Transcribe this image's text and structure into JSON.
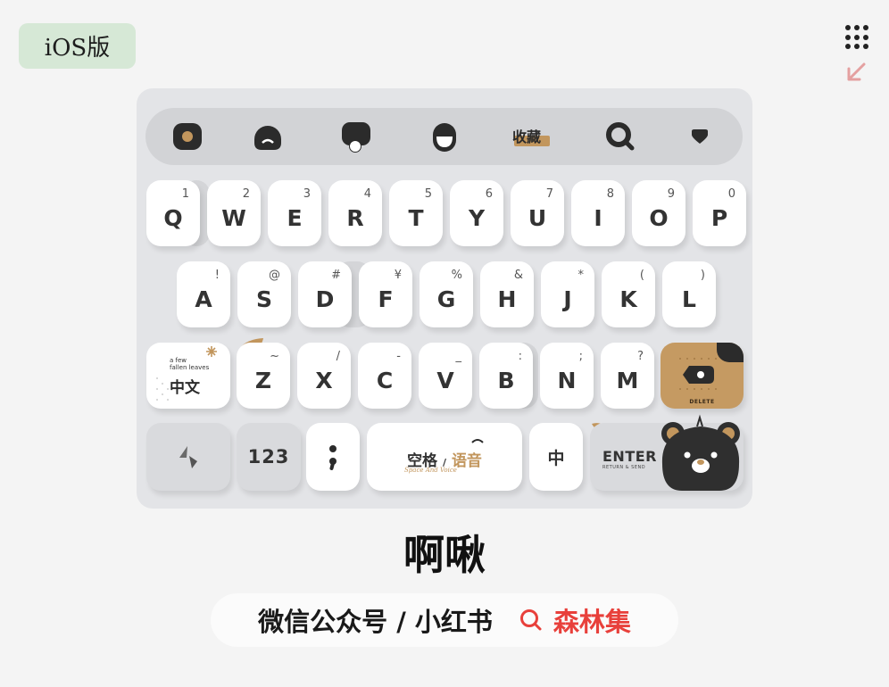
{
  "badge": {
    "label": "iOS版"
  },
  "toolbar": {
    "favorite_label": "收藏"
  },
  "rows": {
    "row1": [
      {
        "key": "Q",
        "sub": "1"
      },
      {
        "key": "W",
        "sub": "2"
      },
      {
        "key": "E",
        "sub": "3"
      },
      {
        "key": "R",
        "sub": "4"
      },
      {
        "key": "T",
        "sub": "5"
      },
      {
        "key": "Y",
        "sub": "6"
      },
      {
        "key": "U",
        "sub": "7"
      },
      {
        "key": "I",
        "sub": "8"
      },
      {
        "key": "O",
        "sub": "9"
      },
      {
        "key": "P",
        "sub": "0"
      }
    ],
    "row2": [
      {
        "key": "A",
        "sub": "!"
      },
      {
        "key": "S",
        "sub": "@"
      },
      {
        "key": "D",
        "sub": "#"
      },
      {
        "key": "F",
        "sub": "¥"
      },
      {
        "key": "G",
        "sub": "%"
      },
      {
        "key": "H",
        "sub": "&"
      },
      {
        "key": "J",
        "sub": "*"
      },
      {
        "key": "K",
        "sub": "("
      },
      {
        "key": "L",
        "sub": ")"
      }
    ],
    "row3": [
      {
        "key": "Z",
        "sub": "~"
      },
      {
        "key": "X",
        "sub": "/"
      },
      {
        "key": "C",
        "sub": "-"
      },
      {
        "key": "V",
        "sub": "_"
      },
      {
        "key": "B",
        "sub": ":"
      },
      {
        "key": "N",
        "sub": ";"
      },
      {
        "key": "M",
        "sub": "?"
      }
    ]
  },
  "keys": {
    "lang_small": "a few\nfallen leaves",
    "lang_main": "中文",
    "delete_label": "DELETE",
    "numbers_label": "123",
    "punct_label": ";",
    "space_left": "空格",
    "space_sep": "/",
    "space_right": "语音",
    "space_sub": "Space And Voice",
    "zh_label": "中",
    "enter_label": "ENTER",
    "enter_sub": "RETURN & SEND"
  },
  "title": "啊啾",
  "footer": {
    "left": "微信公众号 / 小红书",
    "right": "森林集"
  },
  "colors": {
    "accent": "#c2965d",
    "bear": "#2f2f2f",
    "brand_red": "#e8403b",
    "badge_bg": "#d6e8d6"
  }
}
